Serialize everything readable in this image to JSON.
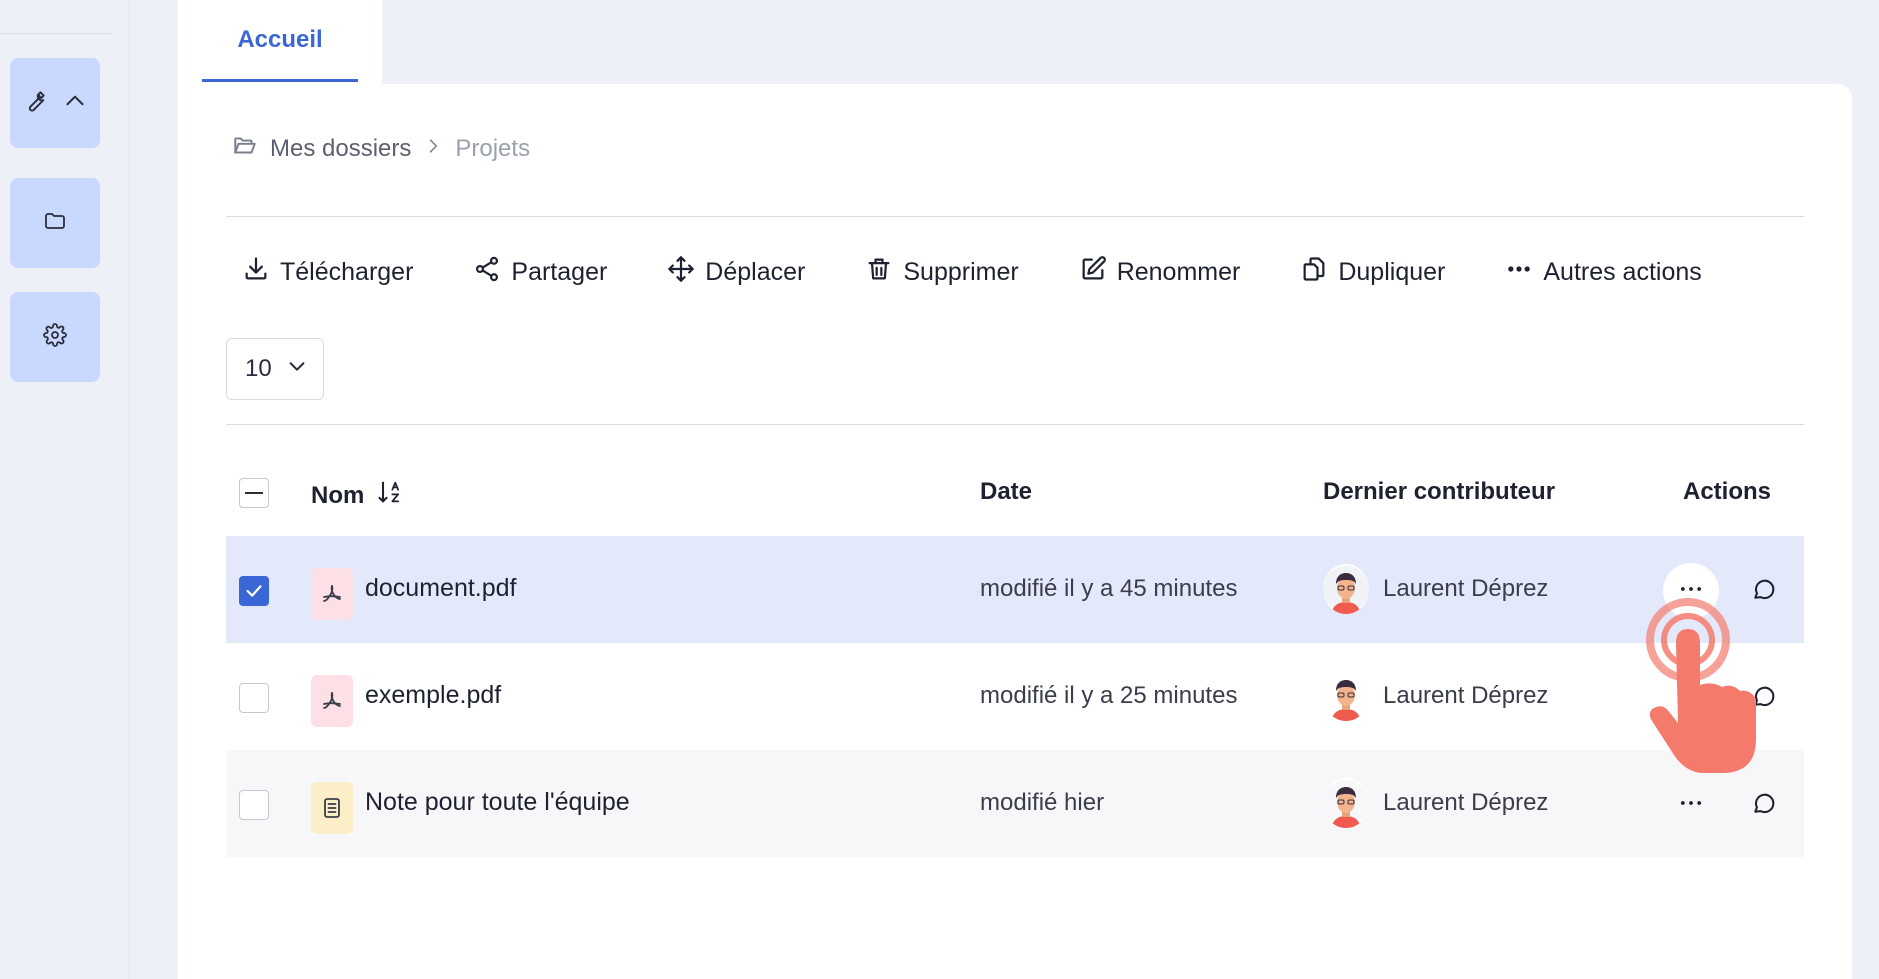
{
  "rail": {
    "items": [
      {
        "icon": "wrench-icon",
        "secondary_icon": "chevron-up-icon"
      },
      {
        "icon": "folder-icon"
      },
      {
        "icon": "gear-icon"
      }
    ]
  },
  "tab": {
    "label": "Accueil"
  },
  "breadcrumb": {
    "root": "Mes dossiers",
    "current": "Projets"
  },
  "toolbar": {
    "download": "Télécharger",
    "share": "Partager",
    "move": "Déplacer",
    "delete": "Supprimer",
    "rename": "Renommer",
    "duplicate": "Dupliquer",
    "more": "Autres actions"
  },
  "page_size": {
    "value": "10"
  },
  "table": {
    "headers": {
      "name": "Nom",
      "date": "Date",
      "contributor": "Dernier contributeur",
      "actions": "Actions"
    },
    "rows": [
      {
        "name": "document.pdf",
        "type": "pdf",
        "date": "modifié il y a 45 minutes",
        "contributor": "Laurent Déprez",
        "selected": true
      },
      {
        "name": "exemple.pdf",
        "type": "pdf",
        "date": "modifié il y a 25 minutes",
        "contributor": "Laurent Déprez",
        "selected": false
      },
      {
        "name": "Note pour toute l'équipe",
        "type": "note",
        "date": "modifié hier",
        "contributor": "Laurent Déprez",
        "selected": false
      }
    ]
  },
  "colors": {
    "accent": "#3b66d6",
    "selected_row": "#e3e9fb",
    "rail_button": "#c9d8ff",
    "pdf_icon_bg": "#fde0e6",
    "note_icon_bg": "#fcefc8",
    "tap_cursor": "#f47a6c"
  }
}
